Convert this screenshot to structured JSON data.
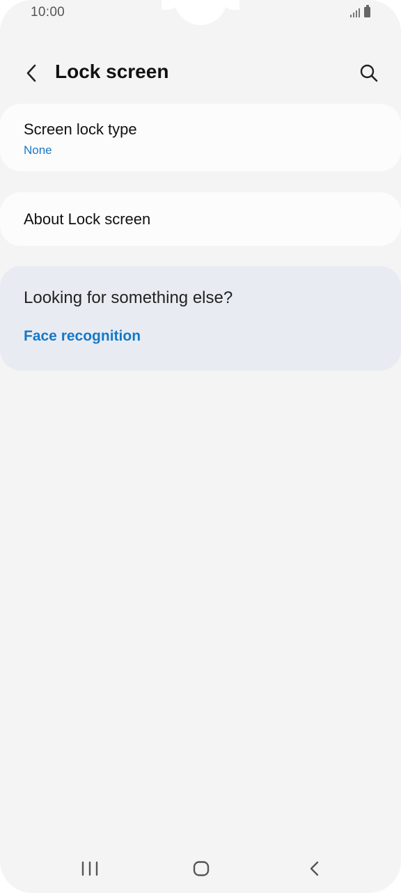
{
  "status_bar": {
    "time": "10:00",
    "icons": [
      "signal-icon",
      "battery-icon"
    ]
  },
  "header": {
    "title": "Lock screen",
    "back_icon": "back-chevron-icon",
    "search_icon": "search-icon"
  },
  "settings": {
    "screen_lock_type": {
      "label": "Screen lock type",
      "value": "None"
    },
    "about": {
      "label": "About Lock screen"
    }
  },
  "suggestions": {
    "title": "Looking for something else?",
    "link": "Face recognition"
  },
  "nav_bar": {
    "icons": [
      "recent-apps-icon",
      "home-icon",
      "back-icon"
    ]
  },
  "colors": {
    "background": "#f4f4f4",
    "card": "#fcfcfc",
    "suggestion_panel": "#e8ecf2",
    "accent_blue": "#1578c8"
  }
}
